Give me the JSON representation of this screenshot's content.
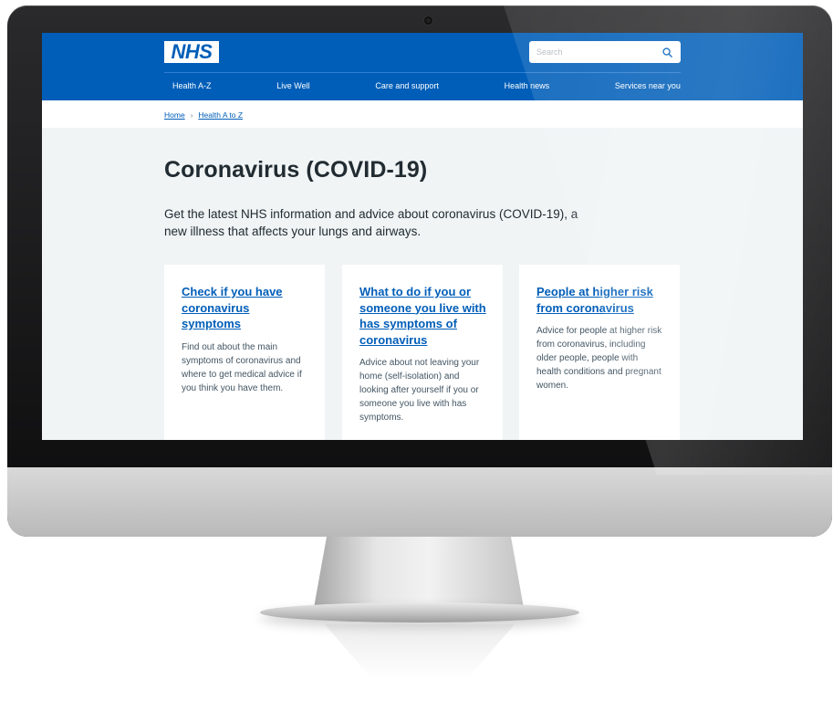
{
  "site": {
    "logo": "NHS",
    "search": {
      "placeholder": "Search"
    },
    "nav": [
      "Health A-Z",
      "Live Well",
      "Care and support",
      "Health news",
      "Services near you"
    ],
    "breadcrumb": [
      "Home",
      "Health A to Z"
    ],
    "title": "Coronavirus (COVID-19)",
    "intro": "Get the latest NHS information and advice about coronavirus (COVID-19), a new illness that affects your lungs and airways.",
    "cards": [
      {
        "heading": "Check if you have coronavirus symptoms",
        "text": "Find out about the main symptoms of coronavirus and where to get medical advice if you think you have them."
      },
      {
        "heading": "What to do if you or someone you live with has symptoms of coronavirus",
        "text": "Advice about not leaving your home (self-isolation) and looking after yourself if you or someone you live with has symptoms."
      },
      {
        "heading": "People at higher risk from coronavirus",
        "text": "Advice for people at higher risk from coronavirus, including older people, people with health conditions and pregnant women."
      }
    ]
  },
  "colors": {
    "nhs_blue": "#005eb8",
    "page_bg": "#f0f4f5",
    "text": "#212b32",
    "secondary_text": "#425563"
  },
  "icons": {
    "search": "search-icon"
  }
}
